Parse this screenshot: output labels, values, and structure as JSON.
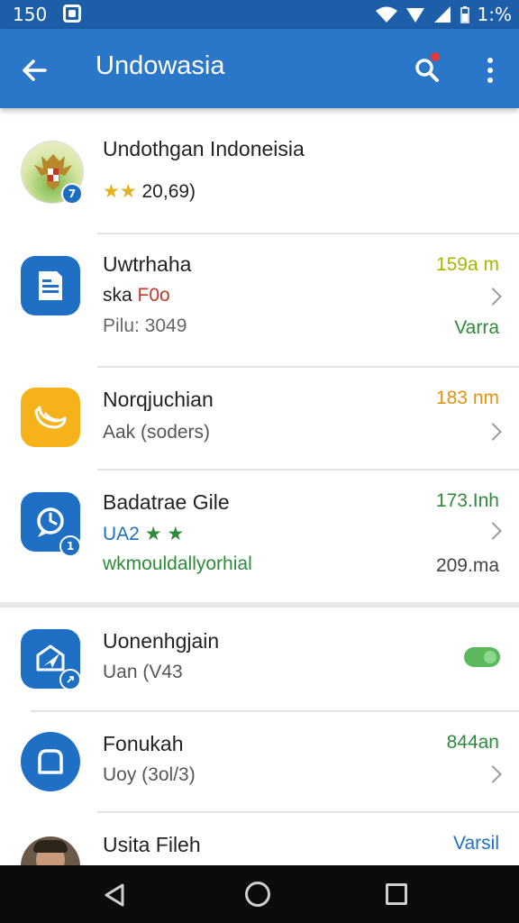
{
  "status_bar": {
    "time": "150",
    "battery": "1:%"
  },
  "app_bar": {
    "title": "Undowasia"
  },
  "items": [
    {
      "title": "Undothgan Indoneisia",
      "rating_stars": "★★",
      "rating_value": "20,69)",
      "icon": "garuda-emblem-icon",
      "badge": "7"
    },
    {
      "title": "Uwtrhaha",
      "line2_prefix": "ska ",
      "line2_highlight": "F0o",
      "line3": "Pilu: 3049",
      "right_top": "159a m",
      "right_bottom": "Varra",
      "icon": "document-icon"
    },
    {
      "title": "Norqjuchian",
      "line2": "Aak (soders)",
      "right_top": "183 nm",
      "icon": "banana-icon"
    },
    {
      "title": "Badatrae Gile",
      "line2_prefix": "UA2 ",
      "line2_stars": "★ ★",
      "line3": "wkmouldallyorhial",
      "right_top": "173.Inh",
      "right_bottom": "209.ma",
      "icon": "clock-chat-icon",
      "badge": "1"
    },
    {
      "title": "Uonenhgjain",
      "line2": "Uan (V43",
      "icon": "mail-plane-icon",
      "toggle_on": true
    },
    {
      "title": "Fonukah",
      "line2": "Uoy (3ol/3)",
      "right_top": "844an",
      "icon": "home-shape-icon"
    },
    {
      "title": "Usita Fileh",
      "right_top": "Varsil",
      "icon": "person-avatar"
    }
  ],
  "colors": {
    "status_bar": "#1c5ea8",
    "app_bar": "#2a76c9",
    "blue_tile": "#1f6fc5",
    "orange_tile": "#f6b21b",
    "yellow_green": "#a5b800",
    "green": "#2e8b3a",
    "orange": "#e29410",
    "red": "#c0392b",
    "blue_text": "#1f6fc5"
  }
}
